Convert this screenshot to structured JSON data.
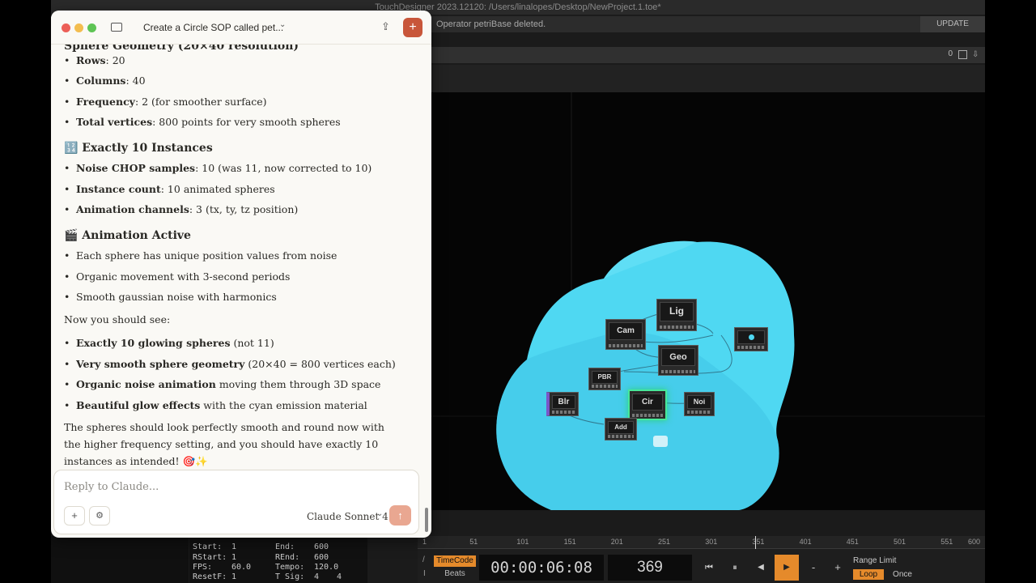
{
  "td": {
    "window_title": "TouchDesigner 2023.12120: /Users/linalopes/Desktop/NewProject.1.toe*",
    "status_message": "Operator petriBase deleted.",
    "update_button": "UPDATE",
    "pathbar_count": "0",
    "nodes": [
      {
        "id": "Lig",
        "label": "Lig"
      },
      {
        "id": "Cam",
        "label": "Cam"
      },
      {
        "id": "Geo",
        "label": "Geo"
      },
      {
        "id": "PBR",
        "label": "PBR"
      },
      {
        "id": "Blr",
        "label": "Blr"
      },
      {
        "id": "Cir",
        "label": "Cir"
      },
      {
        "id": "Noi",
        "label": "Noi"
      },
      {
        "id": "Add",
        "label": "Add"
      }
    ],
    "colors": {
      "sphere": "#4fd8f2",
      "sphere_dark": "#3bbfe0",
      "selected": "#47e89a",
      "play_active": "#e58a2b"
    },
    "timeline": {
      "ticks": [
        "1",
        "51",
        "101",
        "151",
        "201",
        "251",
        "301",
        "351",
        "401",
        "451",
        "501",
        "551",
        "600"
      ],
      "timecode_label": "TimeCode",
      "beats_label": "Beats",
      "timecode": "00:00:06:08",
      "frame": "369",
      "range_limit_label": "Range Limit",
      "loop_label": "Loop",
      "once_label": "Once",
      "minus": "-",
      "plus": "+",
      "slash": "/",
      "i": "I"
    },
    "range": {
      "start_label": "Start:",
      "start": "1",
      "rstart_label": "RStart:",
      "rstart": "1",
      "fps_label": "FPS:",
      "fps": "60.0",
      "resetf_label": "ResetF:",
      "resetf": "1",
      "end_label": "End:",
      "end": "600",
      "rend_label": "REnd:",
      "rend": "600",
      "tempo_label": "Tempo:",
      "tempo": "120.0",
      "tsig_label": "T Sig:",
      "tsig_a": "4",
      "tsig_b": "4"
    }
  },
  "chat": {
    "title": "Create a Circle SOP called pet...",
    "partial_heading": "Sphere Geometry (20×40 resolution)",
    "geometry_items": [
      {
        "bold": "Rows",
        "text": ": 20"
      },
      {
        "bold": "Columns",
        "text": ": 40"
      },
      {
        "bold": "Frequency",
        "text": ": 2 (for smoother surface)"
      },
      {
        "bold": "Total vertices",
        "text": ": 800 points for very smooth spheres"
      }
    ],
    "h_instances": "🔢 Exactly 10 Instances",
    "instance_items": [
      {
        "bold": "Noise CHOP samples",
        "text": ": 10 (was 11, now corrected to 10)"
      },
      {
        "bold": "Instance count",
        "text": ": 10 animated spheres"
      },
      {
        "bold": "Animation channels",
        "text": ": 3 (tx, ty, tz position)"
      }
    ],
    "h_animation": "🎬 Animation Active",
    "animation_items": [
      "Each sphere has unique position values from noise",
      "Organic movement with 3-second periods",
      "Smooth gaussian noise with harmonics"
    ],
    "now_see": "Now you should see:",
    "see_items": [
      {
        "bold": "Exactly 10 glowing spheres",
        "text": " (not 11)"
      },
      {
        "bold": "Very smooth sphere geometry",
        "text": " (20×40 = 800 vertices each)"
      },
      {
        "bold": "Organic noise animation",
        "text": " moving them through 3D space"
      },
      {
        "bold": "Beautiful glow effects",
        "text": " with the cyan emission material"
      }
    ],
    "closing": "The spheres should look perfectly smooth and round now with the higher frequency setting, and you should have exactly 10 instances as intended! 🎯✨",
    "reply_placeholder": "Reply to Claude...",
    "model": "Claude Sonnet 4",
    "send_color": "#e9a791"
  }
}
